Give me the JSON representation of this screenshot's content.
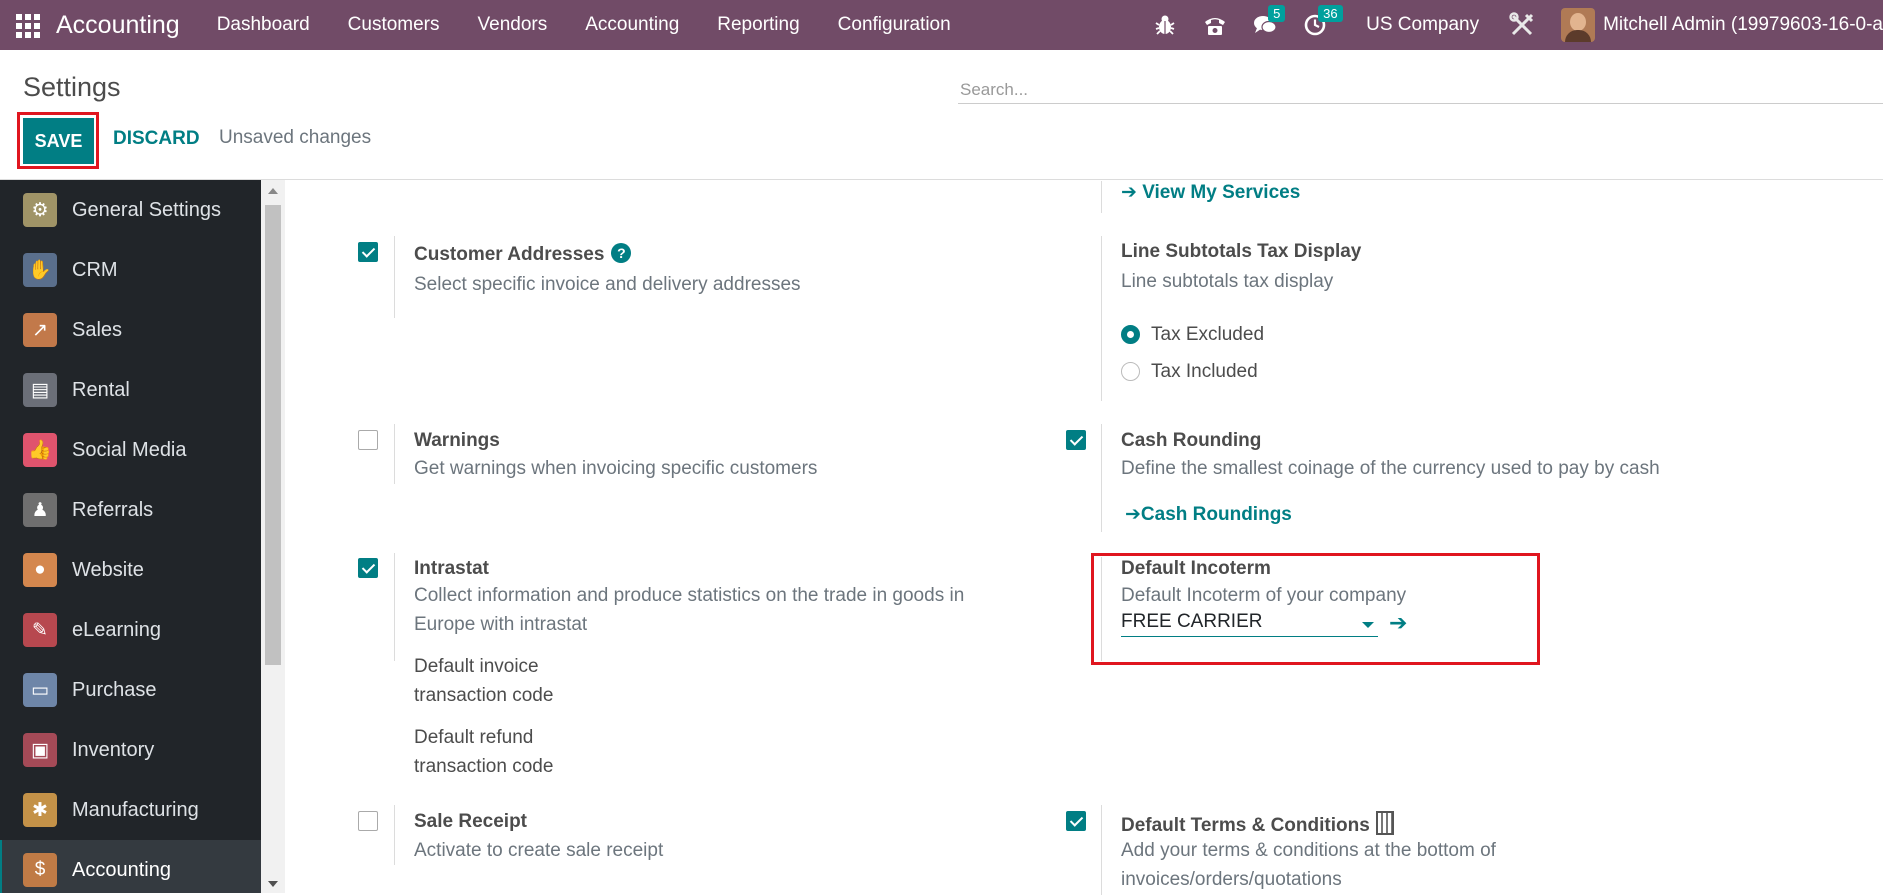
{
  "navbar": {
    "brand": "Accounting",
    "menu": [
      "Dashboard",
      "Customers",
      "Vendors",
      "Accounting",
      "Reporting",
      "Configuration"
    ],
    "messages_count": "5",
    "activities_count": "36",
    "company": "US Company",
    "user": "Mitchell Admin (19979603-16-0-a"
  },
  "control": {
    "title": "Settings",
    "search_placeholder": "Search...",
    "save_label": "SAVE",
    "discard_label": "DISCARD",
    "status": "Unsaved changes"
  },
  "sidebar": {
    "items": [
      {
        "label": "General Settings",
        "icon": "gear-icon",
        "color": "#a09467"
      },
      {
        "label": "CRM",
        "icon": "handshake-icon",
        "color": "#5a6f8c"
      },
      {
        "label": "Sales",
        "icon": "chart-icon",
        "color": "#c2794a"
      },
      {
        "label": "Rental",
        "icon": "rental-icon",
        "color": "#6b6f78"
      },
      {
        "label": "Social Media",
        "icon": "thumbs-up-icon",
        "color": "#e0546d"
      },
      {
        "label": "Referrals",
        "icon": "referrals-icon",
        "color": "#6f6f6f"
      },
      {
        "label": "Website",
        "icon": "globe-icon",
        "color": "#d4874e"
      },
      {
        "label": "eLearning",
        "icon": "elearning-icon",
        "color": "#b7484f"
      },
      {
        "label": "Purchase",
        "icon": "credit-card-icon",
        "color": "#6e86a8"
      },
      {
        "label": "Inventory",
        "icon": "box-icon",
        "color": "#a54a57"
      },
      {
        "label": "Manufacturing",
        "icon": "wrench-icon",
        "color": "#c49248"
      },
      {
        "label": "Accounting",
        "icon": "dollar-doc-icon",
        "color": "#c07b46"
      }
    ]
  },
  "settings": {
    "view_my_services": "View My Services",
    "customer_addresses": {
      "title": "Customer Addresses",
      "desc": "Select specific invoice and delivery addresses",
      "checked": true
    },
    "line_subtotals": {
      "title": "Line Subtotals Tax Display",
      "desc": "Line subtotals tax display",
      "options": [
        "Tax Excluded",
        "Tax Included"
      ],
      "selected": "Tax Excluded"
    },
    "warnings": {
      "title": "Warnings",
      "desc": "Get warnings when invoicing specific customers",
      "checked": false
    },
    "cash_rounding": {
      "title": "Cash Rounding",
      "desc": "Define the smallest coinage of the currency used to pay by cash",
      "link": "Cash Roundings",
      "checked": true
    },
    "intrastat": {
      "title": "Intrastat",
      "desc_line1": "Collect information and produce statistics on the trade in goods in",
      "desc_line2": "Europe with intrastat",
      "invoice_code_line1": "Default invoice",
      "invoice_code_line2": "transaction code",
      "refund_code_line1": "Default refund",
      "refund_code_line2": "transaction code",
      "checked": true
    },
    "default_incoterm": {
      "title": "Default Incoterm",
      "desc": "Default Incoterm of your company",
      "value": "FREE CARRIER"
    },
    "sale_receipt": {
      "title": "Sale Receipt",
      "desc": "Activate to create sale receipt",
      "checked": false
    },
    "default_terms": {
      "title": "Default Terms & Conditions",
      "desc_line1": "Add your terms & conditions at the bottom of",
      "desc_line2": "invoices/orders/quotations",
      "checked": true
    }
  },
  "colors": {
    "brand": "#714b67",
    "accent": "#017e84",
    "highlight": "#e0161f"
  }
}
